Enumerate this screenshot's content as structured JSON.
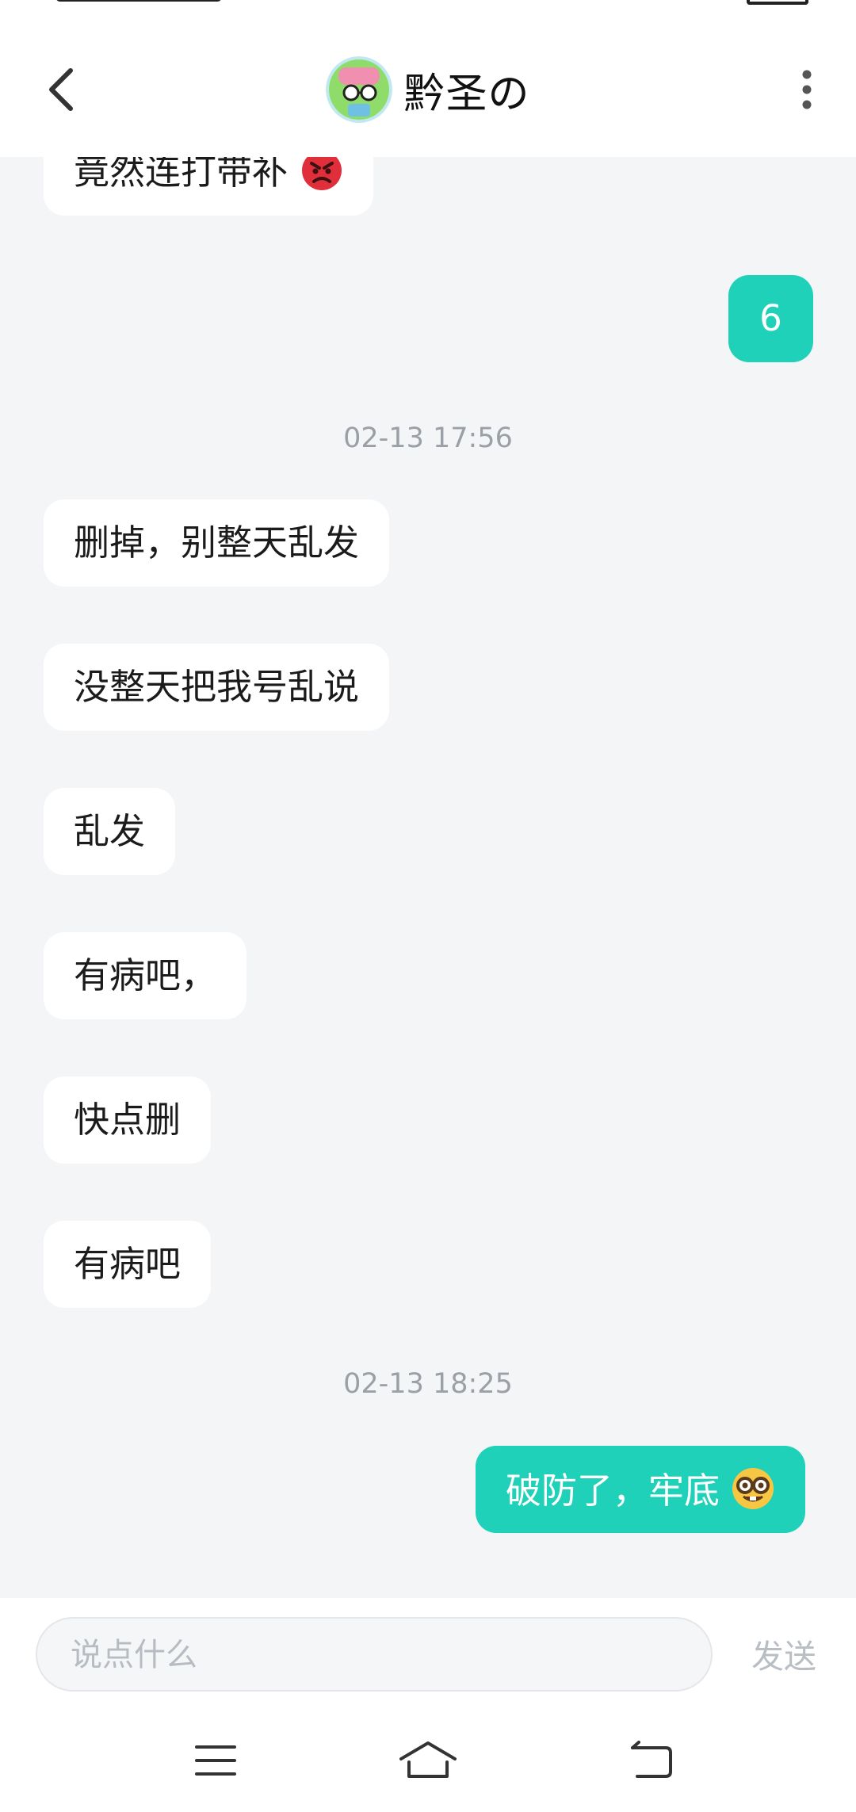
{
  "header": {
    "title": "黔圣の",
    "avatar": "avatar",
    "back_icon": "back-arrow-icon",
    "more_icon": "more-vertical-icon"
  },
  "messages": [
    {
      "side": "in",
      "text": "竟然连打带补",
      "emoji": "angry-face-icon"
    },
    {
      "side": "out",
      "text": "6"
    },
    {
      "timestamp": "02-13 17:56"
    },
    {
      "side": "in",
      "text": "删掉，别整天乱发"
    },
    {
      "side": "in",
      "text": "没整天把我号乱说"
    },
    {
      "side": "in",
      "text": "乱发"
    },
    {
      "side": "in",
      "text": "有病吧，"
    },
    {
      "side": "in",
      "text": "快点删"
    },
    {
      "side": "in",
      "text": "有病吧"
    },
    {
      "timestamp": "02-13 18:25"
    },
    {
      "side": "out",
      "text": "破防了，牢底",
      "emoji": "nerd-face-icon"
    }
  ],
  "composer": {
    "placeholder": "说点什么",
    "send_label": "发送"
  },
  "navbar": {
    "menu_icon": "menu-icon",
    "home_icon": "home-icon",
    "back_icon": "back-icon"
  },
  "colors": {
    "accent": "#1fd1b8",
    "background": "#f4f5f7",
    "timestamp": "#9aa0a6"
  }
}
